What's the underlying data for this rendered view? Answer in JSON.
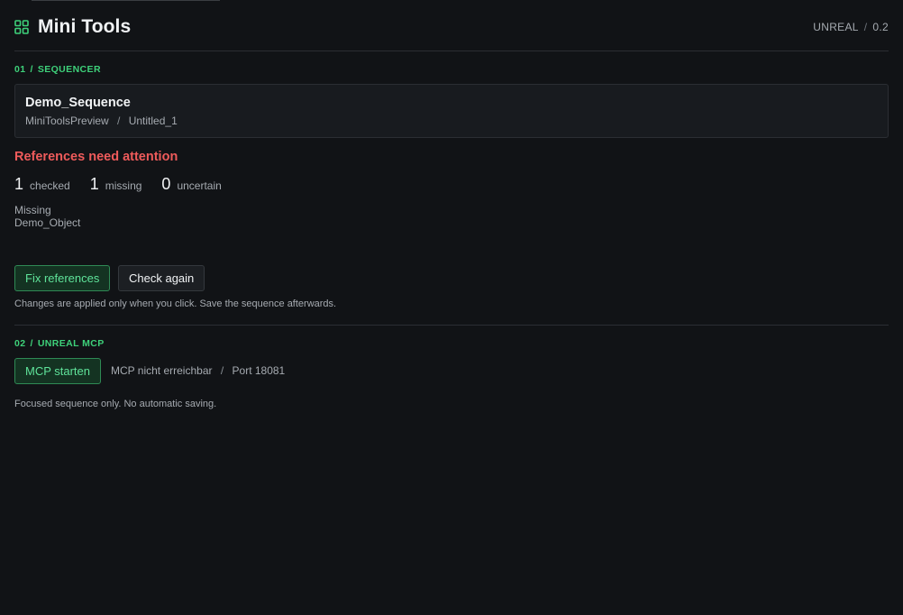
{
  "header": {
    "title": "Mini Tools",
    "icon": "grid-icon",
    "engine": "UNREAL",
    "version": "0.2"
  },
  "colors": {
    "accent": "#3ed17a",
    "danger": "#ef5b5b",
    "background": "#111316"
  },
  "sequencer": {
    "section_number": "01",
    "section_label": "SEQUENCER",
    "sequence_name": "Demo_Sequence",
    "path_parent": "MiniToolsPreview",
    "path_child": "Untitled_1",
    "alert_title": "References need attention",
    "stats": [
      {
        "value": "1",
        "label": "checked"
      },
      {
        "value": "1",
        "label": "missing"
      },
      {
        "value": "0",
        "label": "uncertain"
      }
    ],
    "missing_heading": "Missing",
    "missing_item": "Demo_Object",
    "fix_label": "Fix references",
    "check_label": "Check again",
    "note": "Changes are applied only when you click. Save the sequence afterwards."
  },
  "mcp": {
    "section_number": "02",
    "section_label": "UNREAL MCP",
    "start_label": "MCP starten",
    "status_text": "MCP nicht erreichbar",
    "port_text": "Port 18081",
    "footer_note": "Focused sequence only. No automatic saving."
  }
}
